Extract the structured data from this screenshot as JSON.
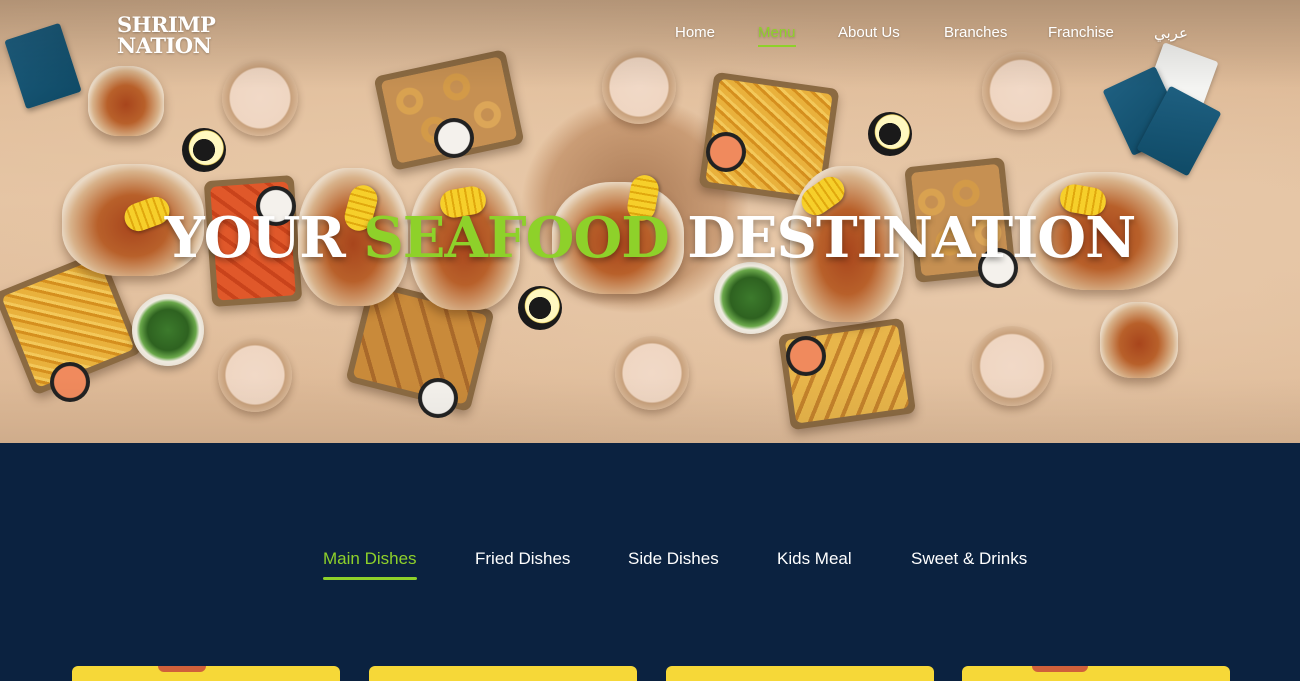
{
  "brand": {
    "logo_line1": "SHRIMP",
    "logo_line2": "NATION"
  },
  "nav": {
    "items": [
      {
        "label": "Home",
        "active": false
      },
      {
        "label": "Menu",
        "active": true
      },
      {
        "label": "About Us",
        "active": false
      },
      {
        "label": "Branches",
        "active": false
      },
      {
        "label": "Franchise",
        "active": false
      },
      {
        "label": "عربي",
        "active": false
      }
    ]
  },
  "hero": {
    "title_part1": "YOUR ",
    "title_accent": "SEAFOOD",
    "title_part2": " DESTINATION"
  },
  "menu": {
    "tabs": [
      {
        "label": "Main Dishes",
        "active": true
      },
      {
        "label": "Fried Dishes",
        "active": false
      },
      {
        "label": "Side Dishes",
        "active": false
      },
      {
        "label": "Kids Meal",
        "active": false
      },
      {
        "label": "Sweet & Drinks",
        "active": false
      }
    ]
  },
  "colors": {
    "accent": "#8ed12a",
    "navy": "#0b2240",
    "card": "#f6d838"
  }
}
